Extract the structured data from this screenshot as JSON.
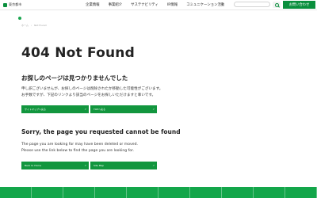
{
  "header": {
    "logo_text": "東京都市",
    "nav": [
      "企業情報",
      "事業紹介",
      "サステナビリティ",
      "IR情報",
      "コミュニケーション活動"
    ],
    "search_placeholder": "",
    "contact_label": "お問い合わせ"
  },
  "breadcrumb": [
    "ホーム",
    "Not Found"
  ],
  "error": {
    "code_title": "404 Not Found",
    "jp_title": "お探しのページは見つかりませんでした",
    "jp_lines": [
      "申し訳ございませんが、お探しのページは削除されたか移動した可能性がございます。",
      "お手数ですが、下記のリンクより該当のページをお探しいただけますと幸いです。"
    ],
    "jp_buttons": [
      "サイトマップへ戻る",
      "TOPへ戻る"
    ],
    "en_title": "Sorry, the page you requested cannot be found",
    "en_lines": [
      "The page you are looking for may have been deleted or moved.",
      "Please use the link below to find the page you are looking for."
    ],
    "en_buttons": [
      "Back to Home",
      "Site Map"
    ]
  },
  "colors": {
    "accent": "#0a8f3d",
    "footer": "#13a64a"
  }
}
